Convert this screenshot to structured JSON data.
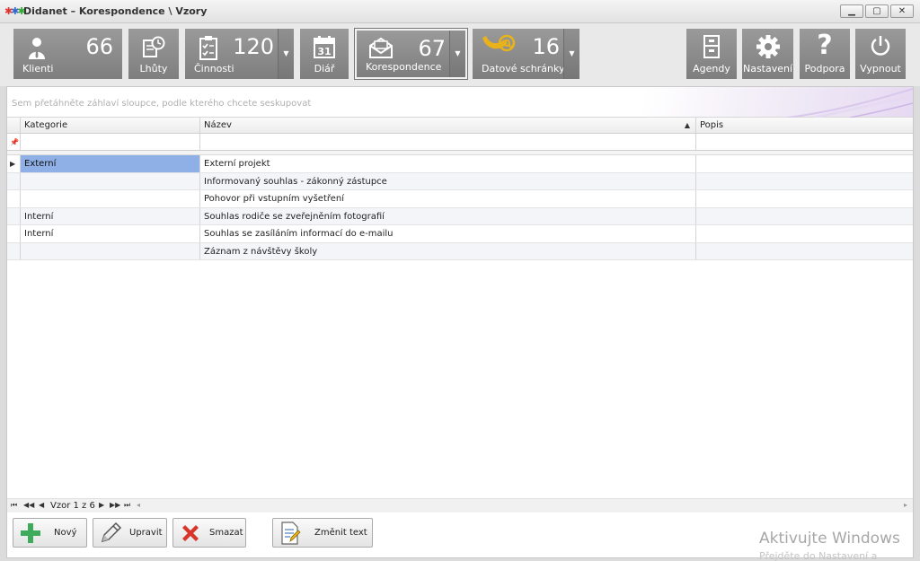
{
  "window": {
    "title": "Didanet – Korespondence \\ Vzory"
  },
  "toolbar": {
    "tiles": [
      {
        "label": "Klienti",
        "count": "66"
      },
      {
        "label": "Lhůty"
      },
      {
        "label": "Činnosti",
        "count": "120"
      },
      {
        "label": "Diář"
      },
      {
        "label": "Korespondence",
        "count": "67"
      },
      {
        "label": "Datové schránky",
        "count": "16"
      }
    ],
    "right_tiles": [
      {
        "label": "Agendy"
      },
      {
        "label": "Nastavení"
      },
      {
        "label": "Podpora"
      },
      {
        "label": "Vypnout"
      }
    ]
  },
  "grid": {
    "group_hint": "Sem přetáhněte záhlaví sloupce, podle kterého chcete seskupovat",
    "columns": [
      "Kategorie",
      "Název",
      "Popis"
    ],
    "rows": [
      {
        "kategorie": "Externí",
        "nazev": "Externí projekt",
        "popis": ""
      },
      {
        "kategorie": "",
        "nazev": "Informovaný souhlas - zákonný zástupce",
        "popis": ""
      },
      {
        "kategorie": "",
        "nazev": "Pohovor při vstupním vyšetření",
        "popis": ""
      },
      {
        "kategorie": "Interní",
        "nazev": "Souhlas rodiče se zveřejněním fotografií",
        "popis": ""
      },
      {
        "kategorie": "Interní",
        "nazev": "Souhlas se zasíláním informací do e-mailu",
        "popis": ""
      },
      {
        "kategorie": "",
        "nazev": "Záznam z návštěvy školy",
        "popis": ""
      }
    ],
    "pager_text": "Vzor 1 z 6"
  },
  "buttons": {
    "new": "Nový",
    "edit": "Upravit",
    "delete": "Smazat",
    "change_text": "Změnit text"
  },
  "watermark": {
    "line1": "Aktivujte Windows",
    "line2": "Přejděte do Nastavení a aktivujte"
  },
  "colors": {
    "tile_bg": "#8a8a8a",
    "selection": "#8fb0e6",
    "add_green": "#3daa5c",
    "delete_red": "#d9362b",
    "bell_gold": "#e8b21a"
  }
}
